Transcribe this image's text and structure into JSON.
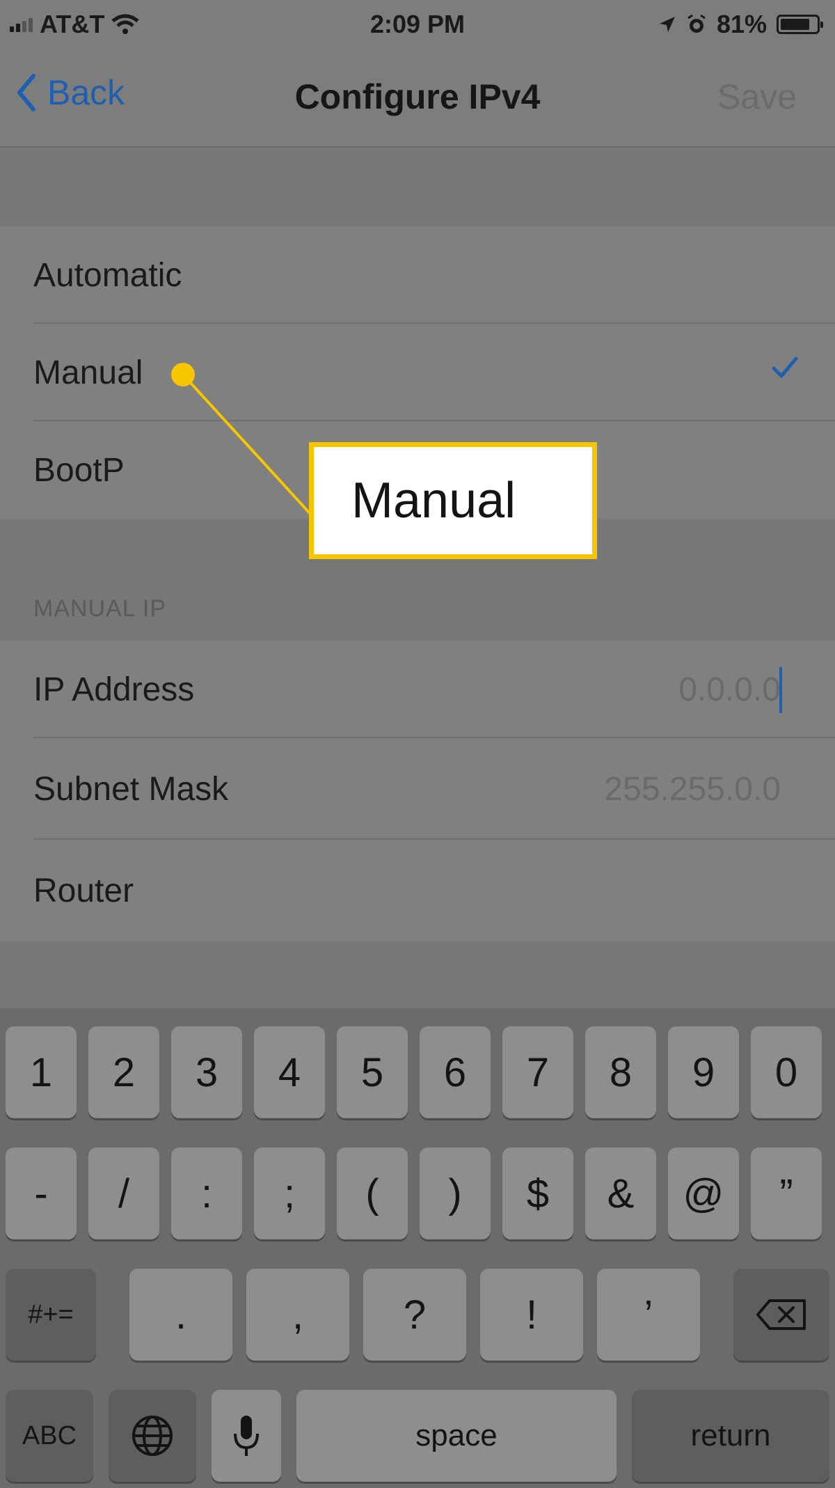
{
  "status_bar": {
    "carrier": "AT&T",
    "time": "2:09 PM",
    "battery_percent": "81%",
    "battery_level": 0.81,
    "icons": [
      "signal-icon",
      "wifi-icon",
      "location-icon",
      "alarm-icon",
      "battery-icon"
    ]
  },
  "nav": {
    "back_label": "Back",
    "title": "Configure IPv4",
    "save_label": "Save"
  },
  "options": [
    {
      "label": "Automatic",
      "selected": false
    },
    {
      "label": "Manual",
      "selected": true
    },
    {
      "label": "BootP",
      "selected": false
    }
  ],
  "manual_ip": {
    "header": "MANUAL IP",
    "fields": [
      {
        "label": "IP Address",
        "value": "0.0.0.0"
      },
      {
        "label": "Subnet Mask",
        "value": "255.255.0.0"
      },
      {
        "label": "Router",
        "value": ""
      }
    ]
  },
  "callout": {
    "text": "Manual",
    "color": "#f7c600"
  },
  "keyboard": {
    "row1": [
      "1",
      "2",
      "3",
      "4",
      "5",
      "6",
      "7",
      "8",
      "9",
      "0"
    ],
    "row2": [
      "-",
      "/",
      ":",
      ";",
      "(",
      ")",
      "$",
      "&",
      "@",
      "”"
    ],
    "row3_left": "#+=",
    "row3": [
      ".",
      ",",
      "?",
      "!",
      "’"
    ],
    "row4": {
      "abc": "ABC",
      "space": "space",
      "return": "return"
    },
    "icons": [
      "globe-icon",
      "microphone-icon",
      "delete-icon"
    ]
  },
  "colors": {
    "accent": "#1d5fb0",
    "callout": "#f7c600"
  }
}
